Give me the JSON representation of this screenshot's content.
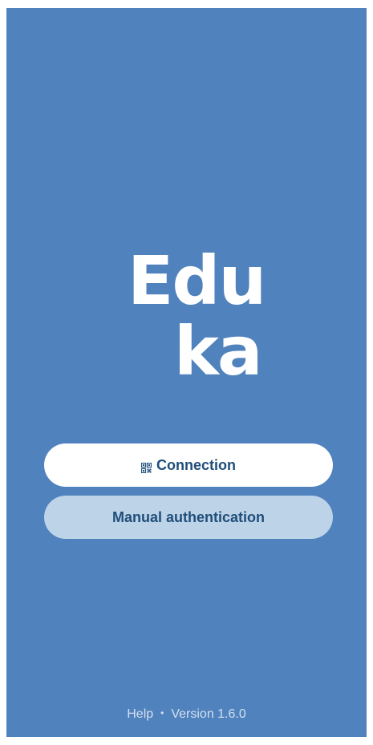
{
  "app": {
    "logo_line1": "Edu",
    "logo_line2": "ka",
    "background_color": "#5082bd"
  },
  "actions": {
    "connection_label": "Connection",
    "connection_icon": "qr-code-icon",
    "manual_auth_label": "Manual authentication"
  },
  "footer": {
    "help_label": "Help",
    "separator": "•",
    "version_label": "Version 1.6.0"
  }
}
